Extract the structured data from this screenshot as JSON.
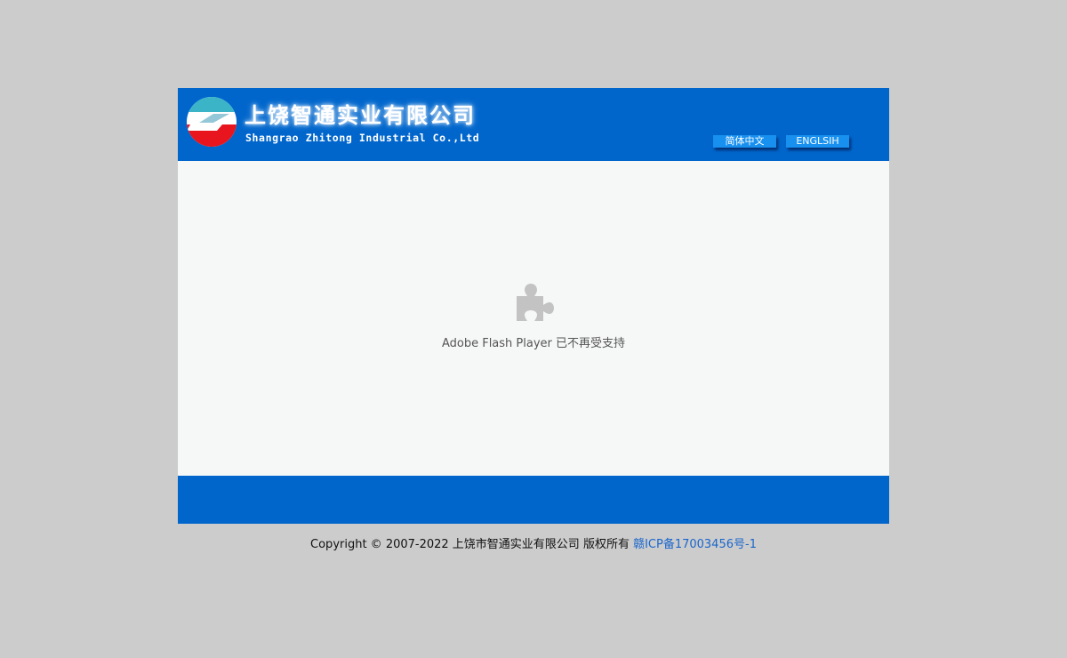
{
  "header": {
    "company_name_cn": "上饶智通实业有限公司",
    "company_name_en": "Shangrao Zhitong Industrial Co.,Ltd",
    "lang_buttons": {
      "cn": "简体中文",
      "en": "ENGLSIH"
    }
  },
  "content": {
    "plugin_icon": "puzzle-piece-icon",
    "plugin_message": "Adobe Flash Player 已不再受支持"
  },
  "footer": {
    "copyright_text": "Copyright © 2007-2022 上饶市智通实业有限公司 版权所有 ",
    "icp_link": "赣ICP备17003456号-1"
  },
  "colors": {
    "page_bg": "#cccccc",
    "brand_blue": "#0066cc",
    "button_blue": "#1890f0",
    "content_bg": "#f6f7f7",
    "link": "#1a66cc",
    "logo_teal": "#3cb4c8",
    "logo_red": "#e8141e"
  }
}
